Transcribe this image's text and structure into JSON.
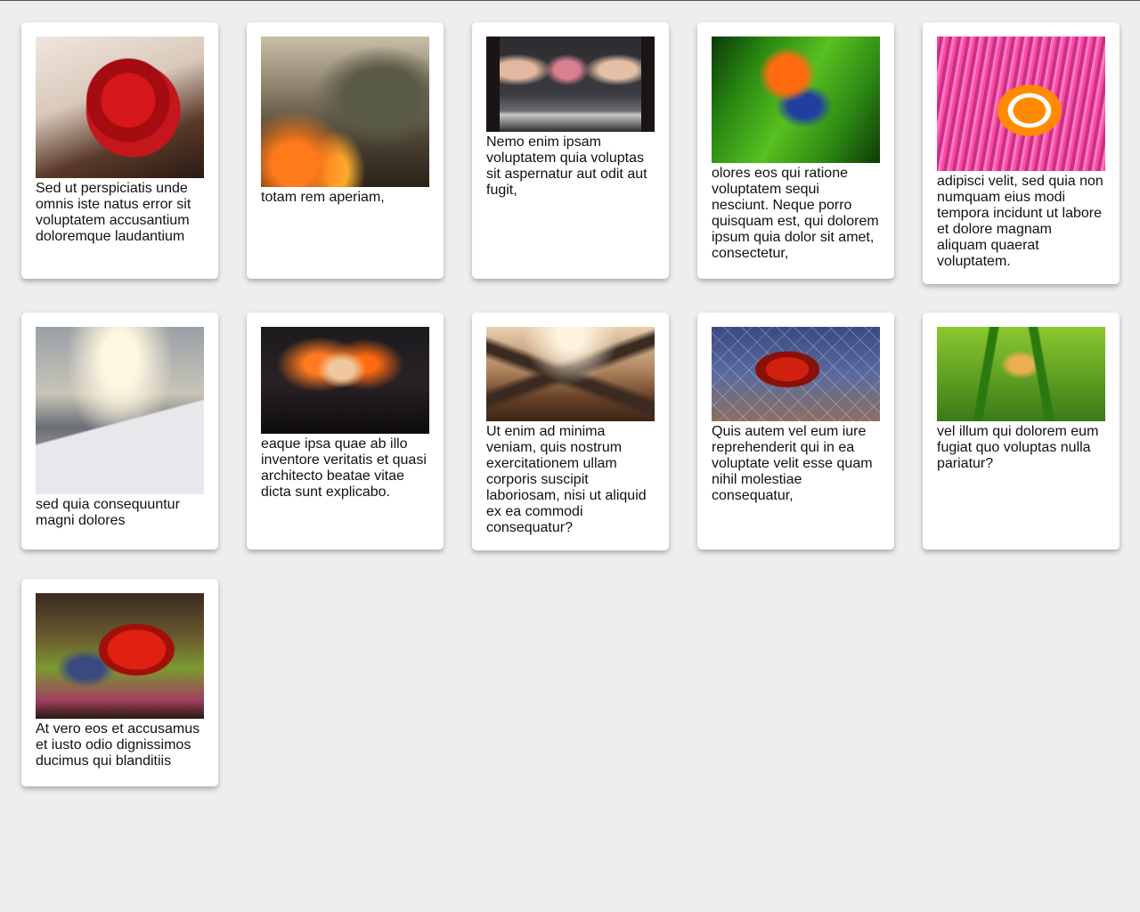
{
  "cards": [
    {
      "caption": "Sed ut perspiciatis unde omnis iste natus error sit voluptatem accusantium doloremque laudantium",
      "image": "red rose on wood"
    },
    {
      "caption": "totam rem aperiam,",
      "image": "soldier in burning battlefield"
    },
    {
      "caption": "Nemo enim ipsam voluptatem quia voluptas sit aspernatur aut odit aut fugit,",
      "image": "women at urinals"
    },
    {
      "caption": "olores eos qui ratione voluptatem sequi nesciunt. Neque porro quisquam est, qui dolorem ipsum quia dolor sit amet, consectetur,",
      "image": "orange poison dart frog on leaf"
    },
    {
      "caption": "adipisci velit, sed quia non numquam eius modi tempora incidunt ut labore et dolore magnam aliquam quaerat voluptatem.",
      "image": "clownfish in anemone"
    },
    {
      "caption": "sed quia consequuntur magni dolores",
      "image": "cross on snowy mountain"
    },
    {
      "caption": "eaque ipsa quae ab illo inventore veritatis et quasi architecto beatae vitae dicta sunt explicabo.",
      "image": "fiery winged figure"
    },
    {
      "caption": "Ut enim ad minima veniam, quis nostrum exercitationem ullam corporis suscipit laboriosam, nisi ut aliquid ex ea commodi consequatur?",
      "image": "dark angel with wings"
    },
    {
      "caption": "Quis autem vel eum iure reprehenderit qui in ea voluptate velit esse quam nihil molestiae consequatur,",
      "image": "spider-man in web"
    },
    {
      "caption": "vel illum qui dolorem eum fugiat quo voluptas nulla pariatur?",
      "image": "tree frog on stems"
    },
    {
      "caption": "At vero eos et accusamus et iusto odio dignissimos ducimus qui blanditiis",
      "image": "red frog on leaf"
    }
  ]
}
